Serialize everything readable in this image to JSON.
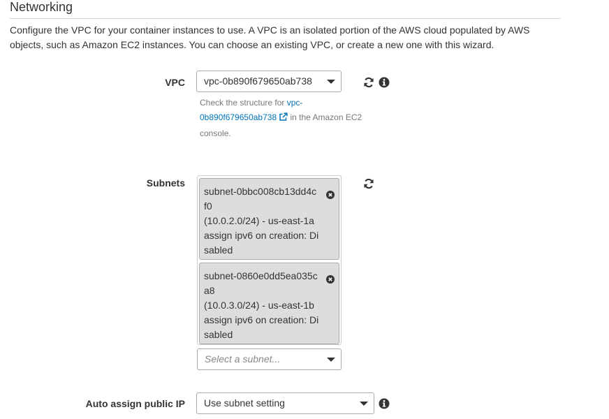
{
  "section": {
    "title": "Networking",
    "description": "Configure the VPC for your container instances to use. A VPC is an isolated portion of the AWS cloud populated by AWS objects, such as Amazon EC2 instances. You can choose an existing VPC, or create a new one with this wizard."
  },
  "vpc": {
    "label": "VPC",
    "selected": "vpc-0b890f679650ab738",
    "help_prefix": "Check the structure for ",
    "help_link": "vpc-0b890f679650ab738",
    "help_suffix": " in the Amazon EC2 console.",
    "icons": [
      "refresh-icon",
      "info-icon"
    ]
  },
  "subnets": {
    "label": "Subnets",
    "items": [
      {
        "id": "subnet-0bbc008cb13dd4cf0",
        "cidr_zone": "(10.0.2.0/24) - us-east-1a",
        "ipv6": "assign ipv6 on creation: Disabled"
      },
      {
        "id": "subnet-0860e0dd5ea035ca8",
        "cidr_zone": "(10.0.3.0/24) - us-east-1b",
        "ipv6": "assign ipv6 on creation: Disabled"
      }
    ],
    "placeholder": "Select a subnet..."
  },
  "auto_ip": {
    "label": "Auto assign public IP",
    "selected": "Use subnet setting"
  },
  "colors": {
    "link": "#0073bb",
    "chip_bg": "#dddddd",
    "icon": "#333333"
  }
}
